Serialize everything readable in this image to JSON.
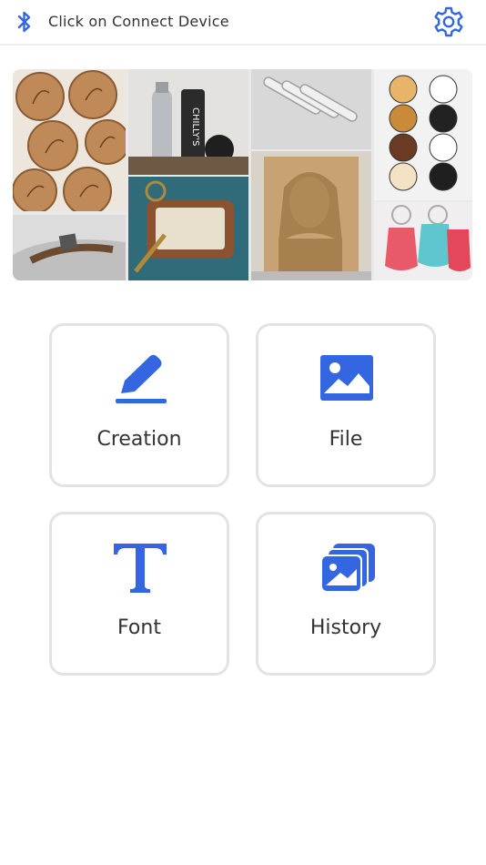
{
  "header": {
    "connect_label": "Click on Connect Device",
    "bluetooth_icon": "bluetooth-icon",
    "settings_icon": "gear-icon"
  },
  "banner": {
    "tiles": [
      "engraved-wood-coasters",
      "engraved-insulated-bottle",
      "engraved-metal-bracelets",
      "printed-pin-buttons",
      "engraved-metal-dog-tag",
      "engraved-leather-keychain",
      "engraved-wood-portrait",
      "printed-acrylic-keychains"
    ],
    "bottle_text": "CHILLY'S"
  },
  "menu": [
    {
      "label": "Creation",
      "icon": "pencil-icon"
    },
    {
      "label": "File",
      "icon": "image-icon"
    },
    {
      "label": "Font",
      "icon": "font-t-icon"
    },
    {
      "label": "History",
      "icon": "gallery-stack-icon"
    }
  ],
  "colors": {
    "accent": "#3366e0",
    "card_border": "#e3e3e3",
    "text": "#333333"
  }
}
